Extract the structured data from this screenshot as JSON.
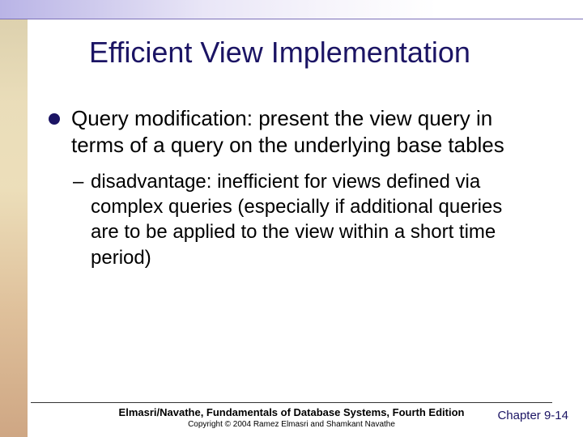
{
  "title": "Efficient View Implementation",
  "bullet1_text": "Query modification: present the view query in terms of a query on the underlying base tables",
  "bullet2_text": "disadvantage: inefficient for views defined via complex queries (especially if additional queries are to be applied to the view within a short time period)",
  "footer_main": "Elmasri/Navathe, Fundamentals of Database Systems, Fourth Edition",
  "footer_sub": "Copyright © 2004 Ramez Elmasri and Shamkant Navathe",
  "page_label": "Chapter 9-14"
}
